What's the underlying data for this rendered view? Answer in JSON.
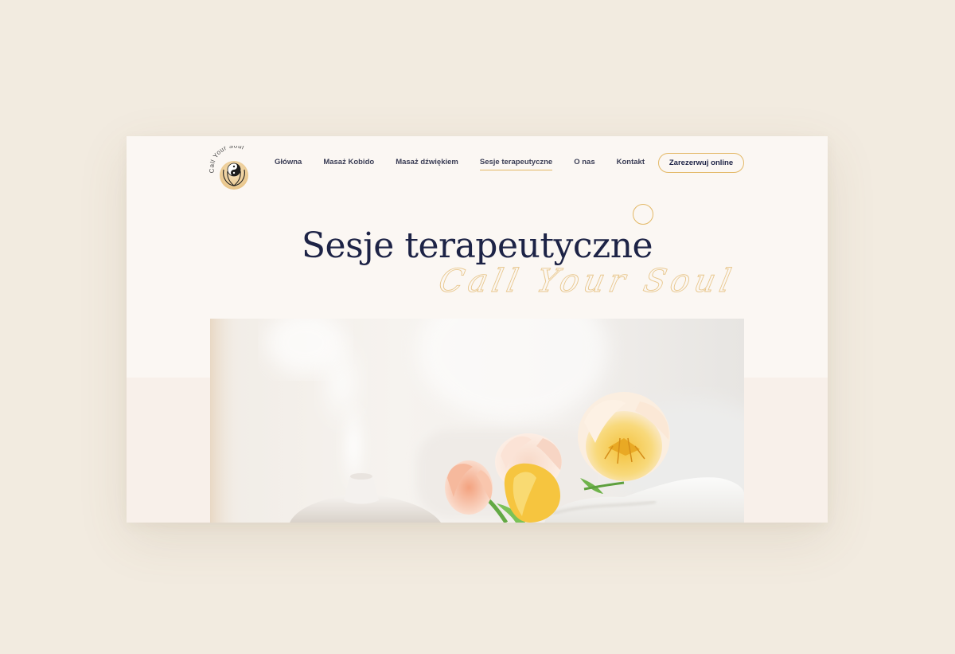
{
  "logo": {
    "text": "Call Your Soul"
  },
  "nav": {
    "items": [
      {
        "label": "Główna",
        "active": false
      },
      {
        "label": "Masaż Kobido",
        "active": false
      },
      {
        "label": "Masaż dźwiękiem",
        "active": false
      },
      {
        "label": "Sesje terapeutyczne",
        "active": true
      },
      {
        "label": "O nas",
        "active": false
      },
      {
        "label": "Kontakt",
        "active": false
      }
    ],
    "cta_label": "Zarezerwuj online"
  },
  "hero": {
    "title": "Sesje terapeutyczne",
    "script_text": "Call Your Soul"
  },
  "colors": {
    "page_background": "#f2ebe0",
    "card_background": "#fbf7f3",
    "navy": "#1d2346",
    "gold": "#e3b866"
  }
}
